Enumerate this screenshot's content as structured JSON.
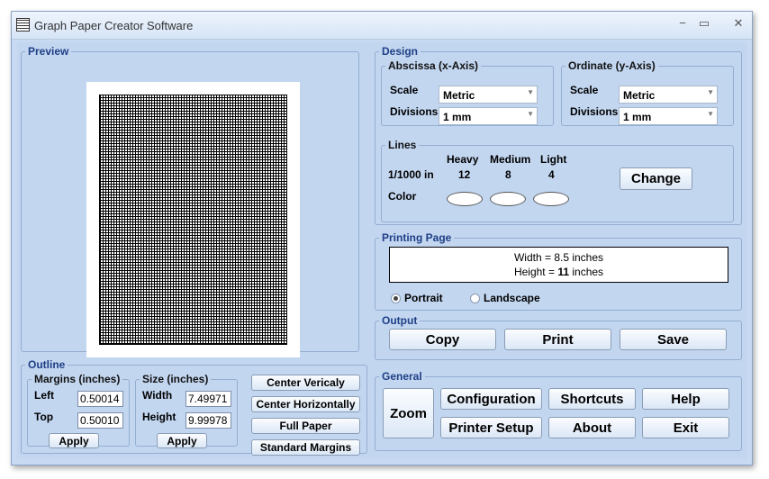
{
  "window": {
    "title": "Graph Paper Creator Software",
    "minimize": "−",
    "maximize": "▭",
    "close": "✕"
  },
  "preview": {
    "legend": "Preview"
  },
  "design": {
    "legend": "Design",
    "abscissa": {
      "legend": "Abscissa (x-Axis)",
      "scale_label": "Scale",
      "scale_value": "Metric",
      "divisions_label": "Divisions",
      "divisions_value": "1 mm"
    },
    "ordinate": {
      "legend": "Ordinate (y-Axis)",
      "scale_label": "Scale",
      "scale_value": "Metric",
      "divisions_label": "Divisions",
      "divisions_value": "1 mm"
    },
    "lines": {
      "legend": "Lines",
      "heavy_label": "Heavy",
      "medium_label": "Medium",
      "light_label": "Light",
      "unit_label": "1/1000 in",
      "heavy_value": "12",
      "medium_value": "8",
      "light_value": "4",
      "color_label": "Color",
      "change_label": "Change"
    }
  },
  "printing_page": {
    "legend": "Printing Page",
    "width_prefix": "Width = ",
    "width_value": "8.5",
    "width_suffix": " inches",
    "height_prefix": "Height = ",
    "height_value": "11",
    "height_suffix": " inches",
    "portrait_label": "Portrait",
    "landscape_label": "Landscape",
    "selected": "portrait"
  },
  "output": {
    "legend": "Output",
    "copy_label": "Copy",
    "print_label": "Print",
    "save_label": "Save"
  },
  "outline": {
    "legend": "Outline",
    "margins": {
      "legend": "Margins (inches)",
      "left_label": "Left",
      "left_value": "0.50014",
      "top_label": "Top",
      "top_value": "0.50010",
      "apply_label": "Apply"
    },
    "size": {
      "legend": "Size (inches)",
      "width_label": "Width",
      "width_value": "7.49971",
      "height_label": "Height",
      "height_value": "9.99978",
      "apply_label": "Apply"
    },
    "center_vertically_label": "Center Vericaly",
    "center_horizontally_label": "Center Horizontally",
    "full_paper_label": "Full Paper",
    "standard_margins_label": "Standard Margins"
  },
  "general": {
    "legend": "General",
    "zoom_label": "Zoom",
    "configuration_label": "Configuration",
    "shortcuts_label": "Shortcuts",
    "help_label": "Help",
    "printer_setup_label": "Printer Setup",
    "about_label": "About",
    "exit_label": "Exit"
  }
}
